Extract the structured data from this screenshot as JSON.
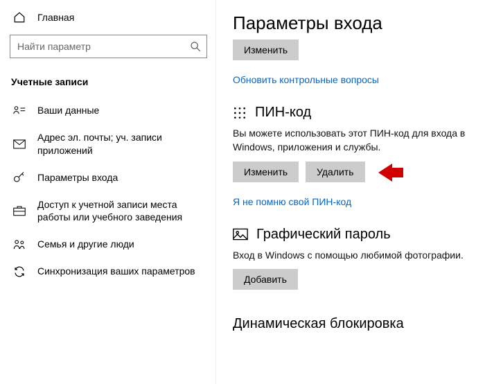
{
  "sidebar": {
    "home": "Главная",
    "search_placeholder": "Найти параметр",
    "category": "Учетные записи",
    "items": [
      {
        "label": "Ваши данные"
      },
      {
        "label": "Адрес эл. почты; уч. записи приложений"
      },
      {
        "label": "Параметры входа"
      },
      {
        "label": "Доступ к учетной записи места работы или учебного заведения"
      },
      {
        "label": "Семья и другие люди"
      },
      {
        "label": "Синхронизация ваших параметров"
      }
    ]
  },
  "content": {
    "page_title": "Параметры входа",
    "top_button": "Изменить",
    "update_questions_link": "Обновить контрольные вопросы",
    "pin": {
      "title": "ПИН-код",
      "desc": "Вы можете использовать этот ПИН-код для входа в Windows, приложения и службы.",
      "change": "Изменить",
      "remove": "Удалить",
      "forgot_link": "Я не помню свой ПИН-код"
    },
    "picture": {
      "title": "Графический пароль",
      "desc": "Вход в Windows с помощью любимой фотографии.",
      "add": "Добавить"
    },
    "dynamic_lock": "Динамическая блокировка"
  }
}
